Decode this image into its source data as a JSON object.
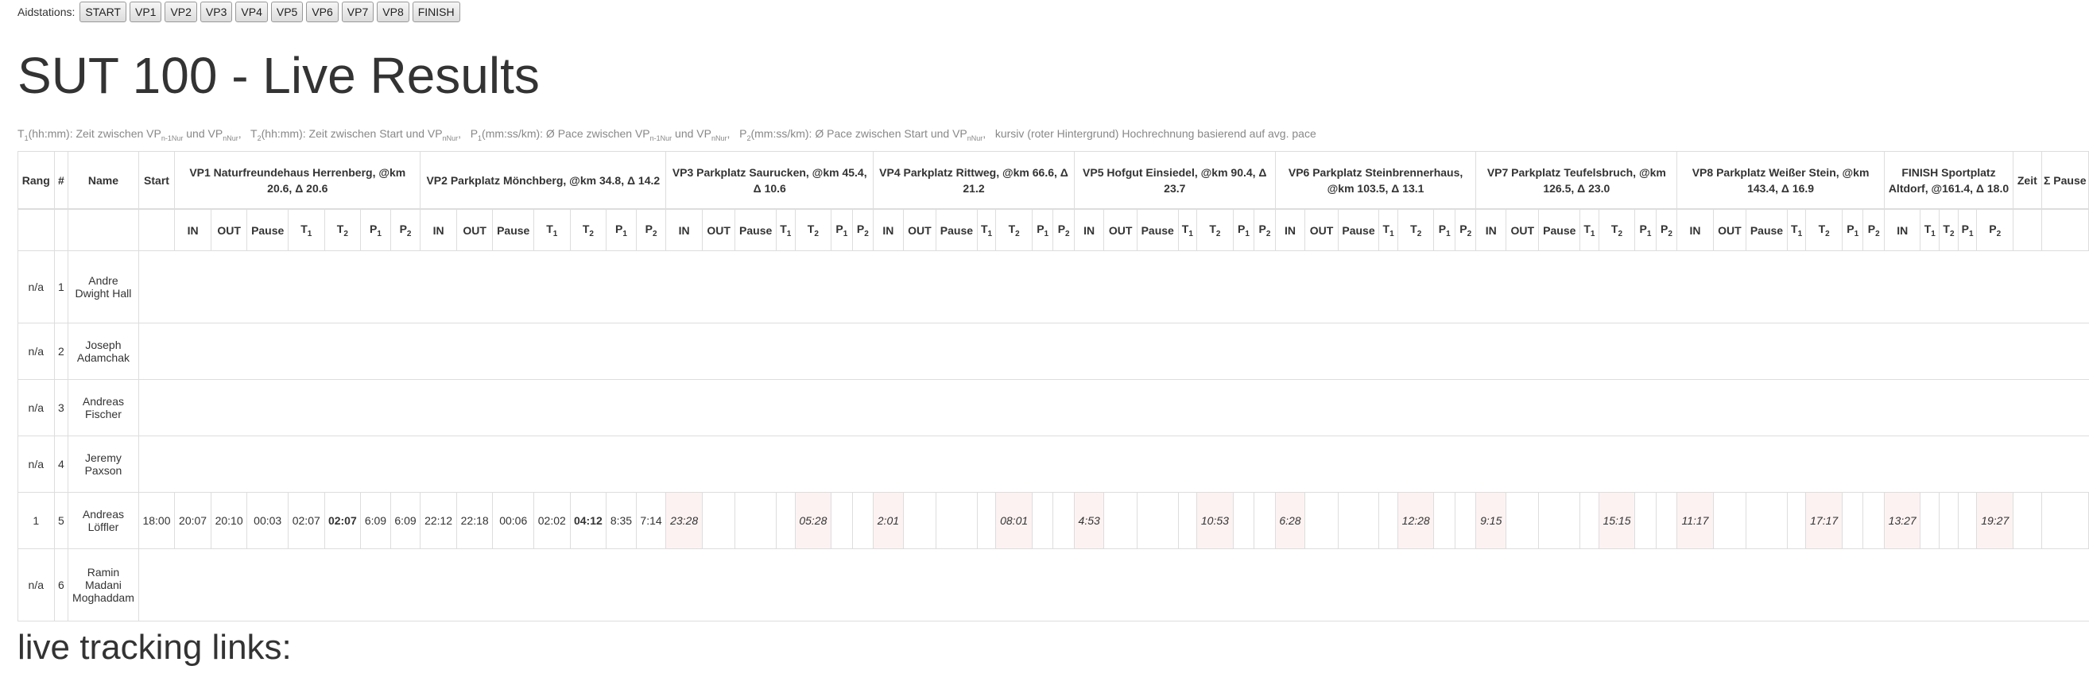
{
  "aidstations": {
    "label": "Aidstations:",
    "buttons": [
      "START",
      "VP1",
      "VP2",
      "VP3",
      "VP4",
      "VP5",
      "VP6",
      "VP7",
      "VP8",
      "FINISH"
    ]
  },
  "title": "SUT 100 - Live Results",
  "legend": {
    "t1": "T",
    "t1_sub": "1",
    "t1_text": "(hh:mm): Zeit zwischen VP",
    "t1_sub2": "n-1",
    "t1_sub3": "Nur",
    "t1_and": " und VP",
    "t1_sub4": "n",
    "t1_sub5": "Nur",
    "t2": "T",
    "t2_sub": "2",
    "t2_text": "(hh:mm): Zeit zwischen Start und VP",
    "t2_sub2": "n",
    "t2_sub3": "Nur",
    "p1": "P",
    "p1_sub": "1",
    "p1_text": "(mm:ss/km): Ø Pace zwischen VP",
    "p1_sub2": "n-1",
    "p1_sub3": "Nur",
    "p1_and": " und VP",
    "p1_sub4": "n",
    "p1_sub5": "Nur",
    "p2": "P",
    "p2_sub": "2",
    "p2_text": "(mm:ss/km): Ø Pace zwischen Start und VP",
    "p2_sub2": "n",
    "p2_sub3": "Nur",
    "tail": "kursiv (roter Hintergrund) Hochrechnung basierend auf avg. pace"
  },
  "table": {
    "headers": {
      "rang": "Rang",
      "num": "#",
      "name": "Name",
      "start": "Start",
      "stations": [
        "VP1 Naturfreundehaus Herrenberg, @km 20.6, Δ 20.6",
        "VP2 Parkplatz Mönchberg, @km 34.8, Δ 14.2",
        "VP3 Parkplatz Saurucken, @km 45.4, Δ 10.6",
        "VP4 Parkplatz Rittweg, @km 66.6, Δ 21.2",
        "VP5 Hofgut Einsiedel, @km 90.4, Δ 23.7",
        "VP6 Parkplatz Steinbrennerhaus, @km 103.5, Δ 13.1",
        "VP7 Parkplatz Teufelsbruch, @km 126.5, Δ 23.0",
        "VP8 Parkplatz Weißer Stein, @km 143.4, Δ 16.9",
        "FINISH Sportplatz Altdorf, @161.4, Δ 18.0"
      ],
      "zeit": "Zeit",
      "sum_pause": "Σ Pause",
      "sub": {
        "in": "IN",
        "out": "OUT",
        "pause": "Pause",
        "t": "T",
        "p": "P",
        "s1": "1",
        "s2": "2"
      }
    },
    "rows": [
      {
        "rang": "n/a",
        "num": "1",
        "name": "Andre Dwight Hall"
      },
      {
        "rang": "n/a",
        "num": "2",
        "name": "Joseph Adamchak"
      },
      {
        "rang": "n/a",
        "num": "3",
        "name": "Andreas Fischer"
      },
      {
        "rang": "n/a",
        "num": "4",
        "name": "Jeremy Paxson"
      },
      {
        "rang": "1",
        "num": "5",
        "name": "Andreas Löffler",
        "start": "18:00",
        "vp1": {
          "in": "20:07",
          "out": "20:10",
          "pause": "00:03",
          "t1": "02:07",
          "t2": "02:07",
          "p1": "6:09",
          "p2": "6:09"
        },
        "vp2": {
          "in": "22:12",
          "out": "22:18",
          "pause": "00:06",
          "t1": "02:02",
          "t2": "04:12",
          "p1": "8:35",
          "p2": "7:14"
        },
        "vp3": {
          "in": "23:28",
          "t2": "05:28"
        },
        "vp4": {
          "in": "2:01",
          "t2": "08:01"
        },
        "vp5": {
          "in": "4:53",
          "t2": "10:53"
        },
        "vp6": {
          "in": "6:28",
          "t2": "12:28"
        },
        "vp7": {
          "in": "9:15",
          "t2": "15:15"
        },
        "vp8": {
          "in": "11:17",
          "t2": "17:17"
        },
        "finish": {
          "in": "13:27",
          "t2": "19:27"
        }
      },
      {
        "rang": "n/a",
        "num": "6",
        "name": "Ramin Madani Moghaddam"
      }
    ]
  },
  "footer_heading": "live tracking links:"
}
